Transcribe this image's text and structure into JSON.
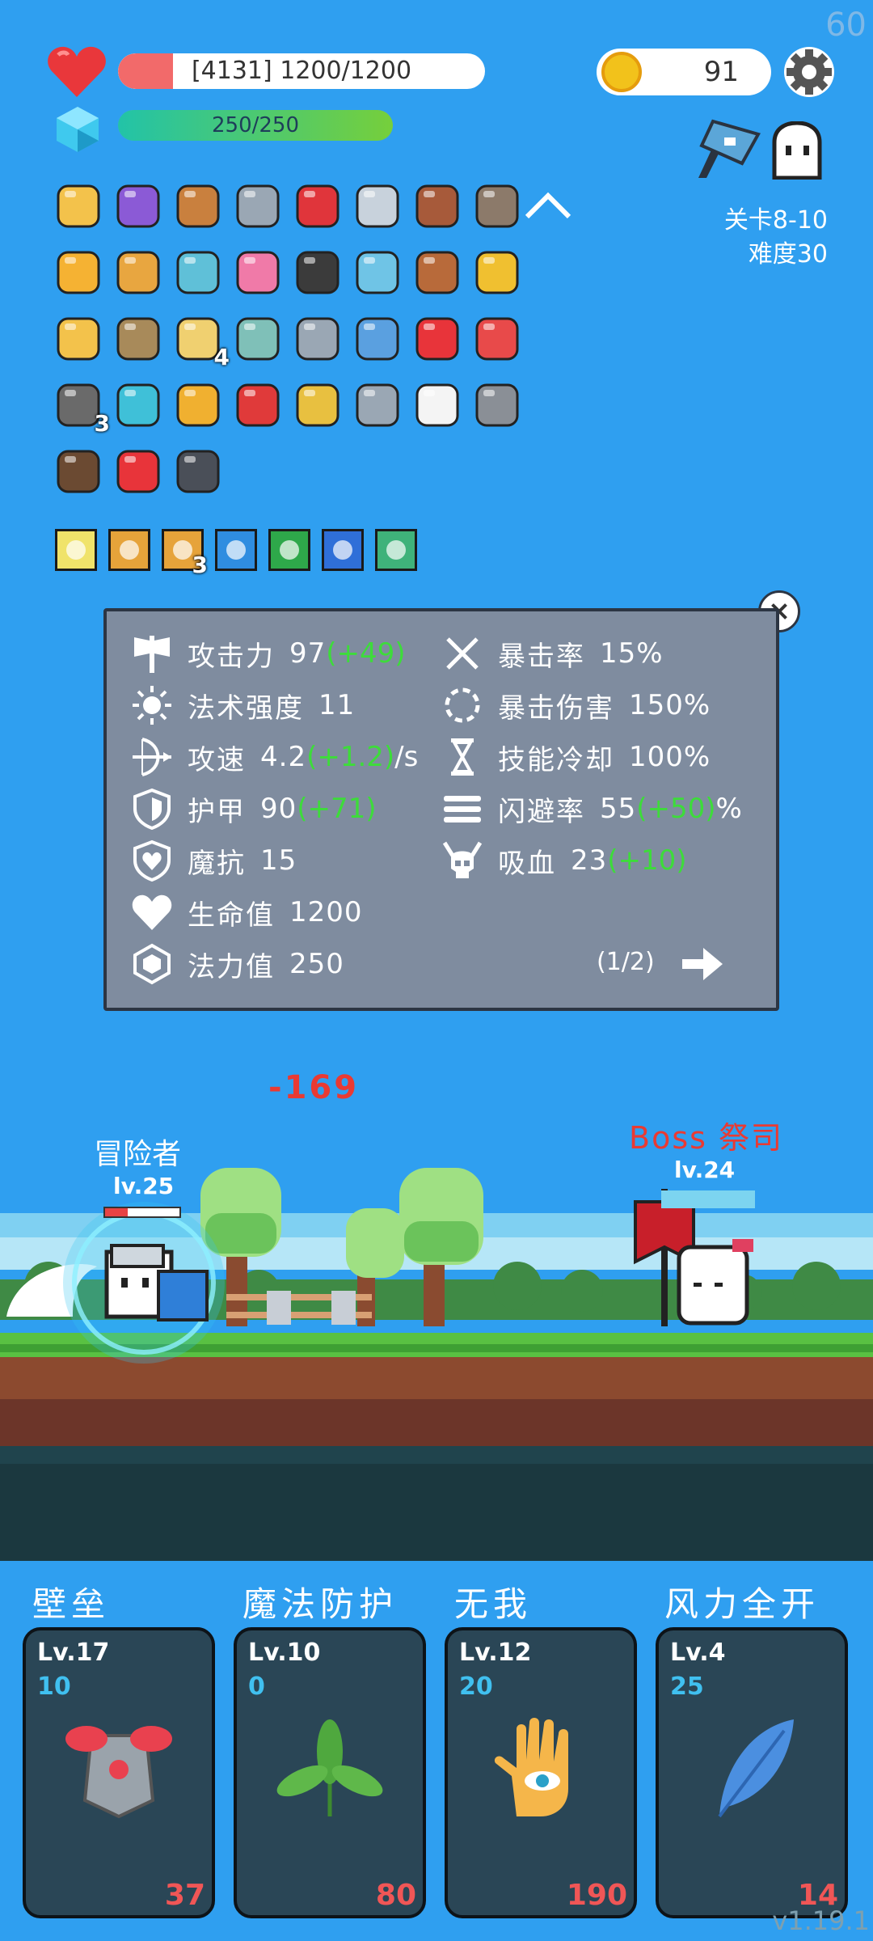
{
  "fps": "60",
  "player": {
    "hp_text": "[4131] 1200/1200",
    "hp_fraction": 0.15,
    "mp_text": "250/250",
    "mp_fraction": 1.0
  },
  "coins": "91",
  "stage": {
    "level": "关卡8-10",
    "difficulty": "难度30"
  },
  "items": [
    {
      "name": "treasure-map-icon"
    },
    {
      "name": "purple-box-icon"
    },
    {
      "name": "round-shield-icon"
    },
    {
      "name": "dagger-icon"
    },
    {
      "name": "magnet-icon"
    },
    {
      "name": "sword-icon"
    },
    {
      "name": "furnace-icon"
    },
    {
      "name": "meteor-icon"
    },
    {
      "name": "beer-icon"
    },
    {
      "name": "book-icon"
    },
    {
      "name": "feather-icon"
    },
    {
      "name": "potion-bottle-icon"
    },
    {
      "name": "cauldron-icon"
    },
    {
      "name": "orb-potion-icon"
    },
    {
      "name": "coconut-drink-icon"
    },
    {
      "name": "mango-icon"
    },
    {
      "name": "scroll-icon"
    },
    {
      "name": "viking-helmet-icon"
    },
    {
      "name": "map-icon",
      "count": "4"
    },
    {
      "name": "disc-shield-icon"
    },
    {
      "name": "battle-axe-icon"
    },
    {
      "name": "shirt-icon"
    },
    {
      "name": "strawberry-icon"
    },
    {
      "name": "watermelon-icon"
    },
    {
      "name": "mortar-icon",
      "count": "3"
    },
    {
      "name": "target-icon"
    },
    {
      "name": "pineapple-icon"
    },
    {
      "name": "sock-icon"
    },
    {
      "name": "ring-icon"
    },
    {
      "name": "molecule-icon"
    },
    {
      "name": "ghost-icon"
    },
    {
      "name": "spiked-mace-icon"
    },
    {
      "name": "coconut-icon"
    },
    {
      "name": "apple-icon"
    },
    {
      "name": "skull-tome-icon"
    }
  ],
  "runes": [
    {
      "name": "light-rune-icon",
      "color": "#f0e36a"
    },
    {
      "name": "shield-rune-icon",
      "color": "#e6a33a"
    },
    {
      "name": "shield-rune-icon",
      "color": "#e6a33a",
      "count": "3"
    },
    {
      "name": "vortex-rune-icon",
      "color": "#2f8de0"
    },
    {
      "name": "poison-rune-icon",
      "color": "#2ea84a"
    },
    {
      "name": "ice-rune-icon",
      "color": "#2f6fd8"
    },
    {
      "name": "ghost-rune-icon",
      "color": "#3fb27a"
    }
  ],
  "stats": {
    "attack": {
      "label": "攻击力",
      "value": "97",
      "bonus": "(+49)"
    },
    "spell_power": {
      "label": "法术强度",
      "value": "11"
    },
    "attack_speed": {
      "label": "攻速",
      "value": "4.2",
      "bonus": "(+1.2)",
      "suffix": "/s"
    },
    "armor": {
      "label": "护甲",
      "value": "90",
      "bonus": "(+71)"
    },
    "magic_resist": {
      "label": "魔抗",
      "value": "15"
    },
    "health": {
      "label": "生命值",
      "value": "1200"
    },
    "mana": {
      "label": "法力值",
      "value": "250"
    },
    "crit_rate": {
      "label": "暴击率",
      "value": "15%"
    },
    "crit_damage": {
      "label": "暴击伤害",
      "value": "150%"
    },
    "cooldown": {
      "label": "技能冷却",
      "value": "100%"
    },
    "dodge": {
      "label": "闪避率",
      "value": "55",
      "bonus": "(+50)",
      "suffix": "%"
    },
    "lifesteal": {
      "label": "吸血",
      "value": "23",
      "bonus": "(+10)"
    },
    "page": "(1/2)"
  },
  "battle": {
    "damage": "-169",
    "hero": {
      "name": "冒险者",
      "level": "lv.25",
      "hp_fraction": 0.3
    },
    "boss": {
      "name": "Boss 祭司",
      "level": "lv.24"
    }
  },
  "skills": [
    {
      "title": "壁垒",
      "level": "Lv.17",
      "mp": "10",
      "cost": "37",
      "icon": "armor-icon"
    },
    {
      "title": "魔法防护",
      "level": "Lv.10",
      "mp": "0",
      "cost": "80",
      "icon": "leaf-icon"
    },
    {
      "title": "无我",
      "level": "Lv.12",
      "mp": "20",
      "cost": "190",
      "icon": "eye-hand-icon"
    },
    {
      "title": "风力全开",
      "level": "Lv.4",
      "mp": "25",
      "cost": "14",
      "icon": "blue-feather-icon"
    }
  ],
  "version": "v1.19.1"
}
